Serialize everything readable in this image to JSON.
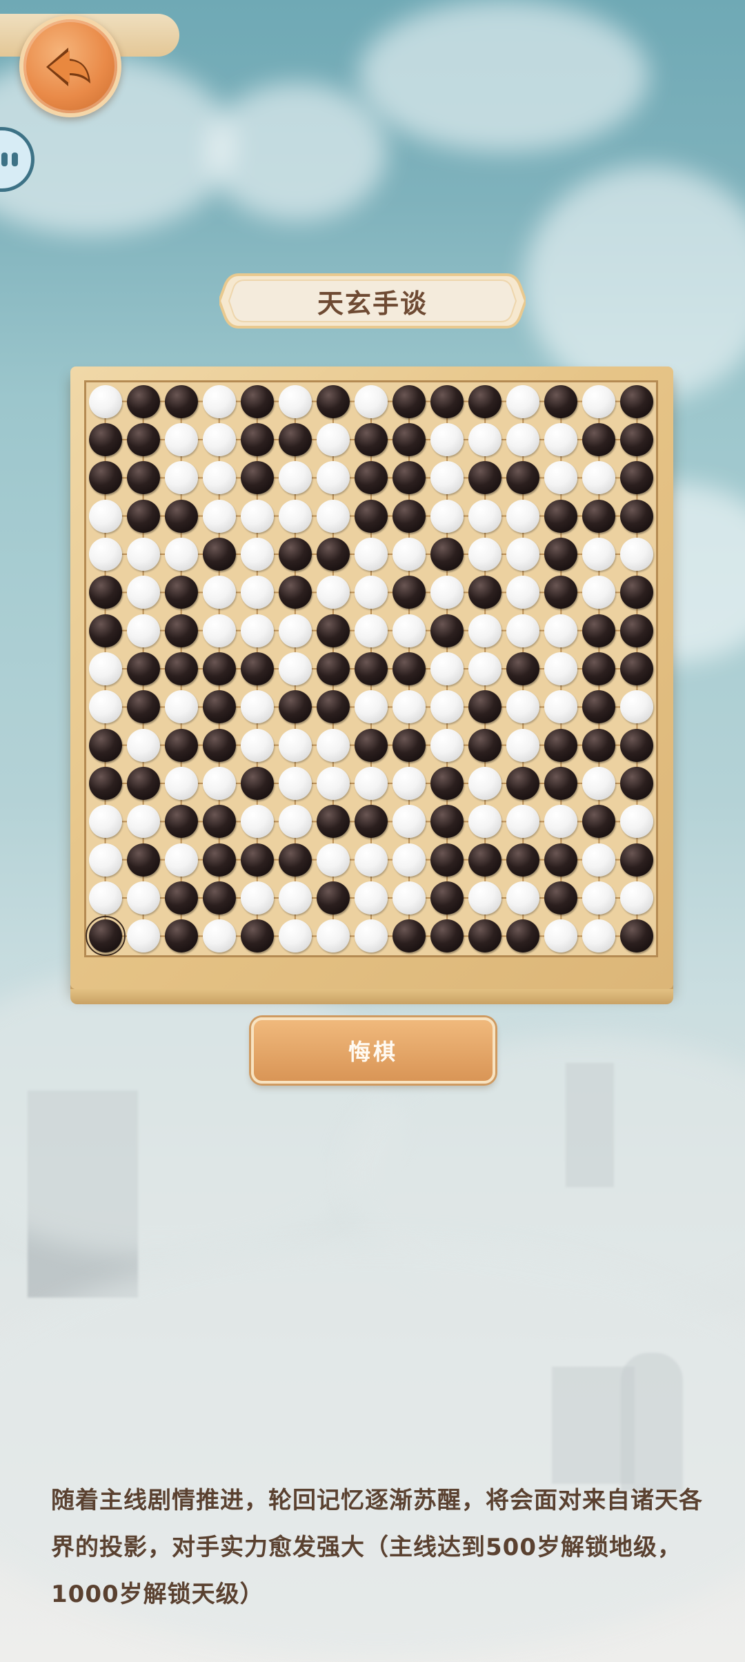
{
  "header": {
    "back_icon": "back-arrow-icon",
    "pause_icon": "pause-icon"
  },
  "title": "天玄手谈",
  "undo_label": "悔棋",
  "description": "随着主线剧情推进，轮回记忆逐渐苏醒，将会面对来自诸天各界的投影，对手实力愈发强大（主线达到500岁解锁地级，1000岁解锁天级）",
  "board": {
    "size": 15,
    "last_move": [
      14,
      0
    ],
    "rows": [
      "WBBWBWBWBBBWBWB",
      "BBWWBBWBBWWWWBB",
      "BBWWBWWBBWBBWWB",
      "WBBWWWWBBWWWBBB",
      "WWWBWBBWWBWWBWW",
      "BWBWWBWWBWBWBWB",
      "BWBWWWBWWBWWWBB",
      "WBBBBWBBBWWBWBB",
      "WBWBWBBWWWBWWBW",
      "BWBBWWWBBWBWBBB",
      "BBWWBWWWWBWBBWB",
      "WWBBWWBBWBWWWBW",
      "WBWBBBWWWBBBBWB",
      "WWBBWWBWWBWWBWW",
      "BWBWBWWWBBBBWWB"
    ]
  }
}
